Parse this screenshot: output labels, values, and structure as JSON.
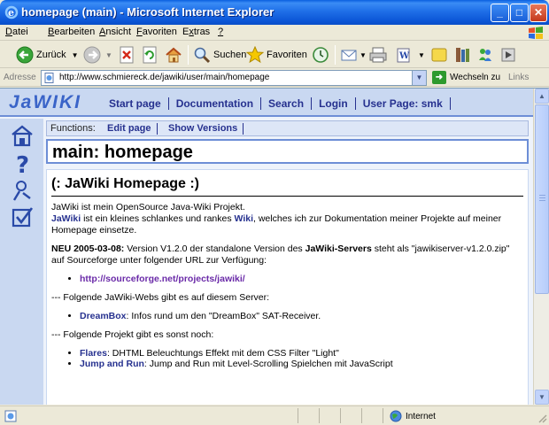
{
  "window": {
    "title": "homepage (main) - Microsoft Internet Explorer"
  },
  "menu": [
    {
      "pre": "",
      "u": "D",
      "post": "atei"
    },
    {
      "pre": "",
      "u": "B",
      "post": "earbeiten"
    },
    {
      "pre": "",
      "u": "A",
      "post": "nsicht"
    },
    {
      "pre": "",
      "u": "F",
      "post": "avoriten"
    },
    {
      "pre": "E",
      "u": "x",
      "post": "tras"
    },
    {
      "pre": "",
      "u": "?",
      "post": ""
    }
  ],
  "toolbar": {
    "back_label": "Zurück",
    "search_label": "Suchen",
    "favorites_label": "Favoriten"
  },
  "address": {
    "label": "Adresse",
    "url": "http://www.schmiereck.de/jawiki/user/main/homepage",
    "go_label": "Wechseln zu",
    "links_label": "Links"
  },
  "wiki": {
    "logo": "JaWIKI",
    "nav": [
      "Start page",
      "Documentation",
      "Search",
      "Login",
      "User Page: smk"
    ],
    "functions_label": "Functions:",
    "functions": [
      "Edit page",
      "Show Versions"
    ],
    "page_title": "main: homepage"
  },
  "content": {
    "heading": "(: JaWiki Homepage :)",
    "intro_line1": "JaWiki ist mein OpenSource Java-Wiki Projekt.",
    "intro_link1": "JaWiki",
    "intro_mid": " ist ein kleines schlankes und rankes ",
    "intro_link2": "Wiki",
    "intro_end": ", welches ich zur Dokumentation meiner Projekte auf meiner Homepage einsetze.",
    "news_label": "NEU 2005-03-08:",
    "news_text1": " Version V1.2.0 der standalone Version des ",
    "news_bold": "JaWiki-Servers",
    "news_text2": " steht als \"jawikiserver-v1.2.0.zip\" auf Sourceforge unter folgender URL zur Verfügung:",
    "sf_url": "http://sourceforge.net/projects/jawiki/",
    "webs_intro": "--- Folgende JaWiki-Webs gibt es auf diesem Server:",
    "web1_link": "DreamBox",
    "web1_text": ": Infos rund um den \"DreamBox\" SAT-Receiver.",
    "projects_intro": "--- Folgende Projekt gibt es sonst noch:",
    "proj1_link": "Flares",
    "proj1_text": ": DHTML Beleuchtungs Effekt mit dem CSS Filter \"Light\"",
    "proj2_link": "Jump and Run",
    "proj2_text": ": Jump and Run mit Level-Scrolling Spielchen mit JavaScript"
  },
  "status": {
    "zone_label": "Internet"
  }
}
